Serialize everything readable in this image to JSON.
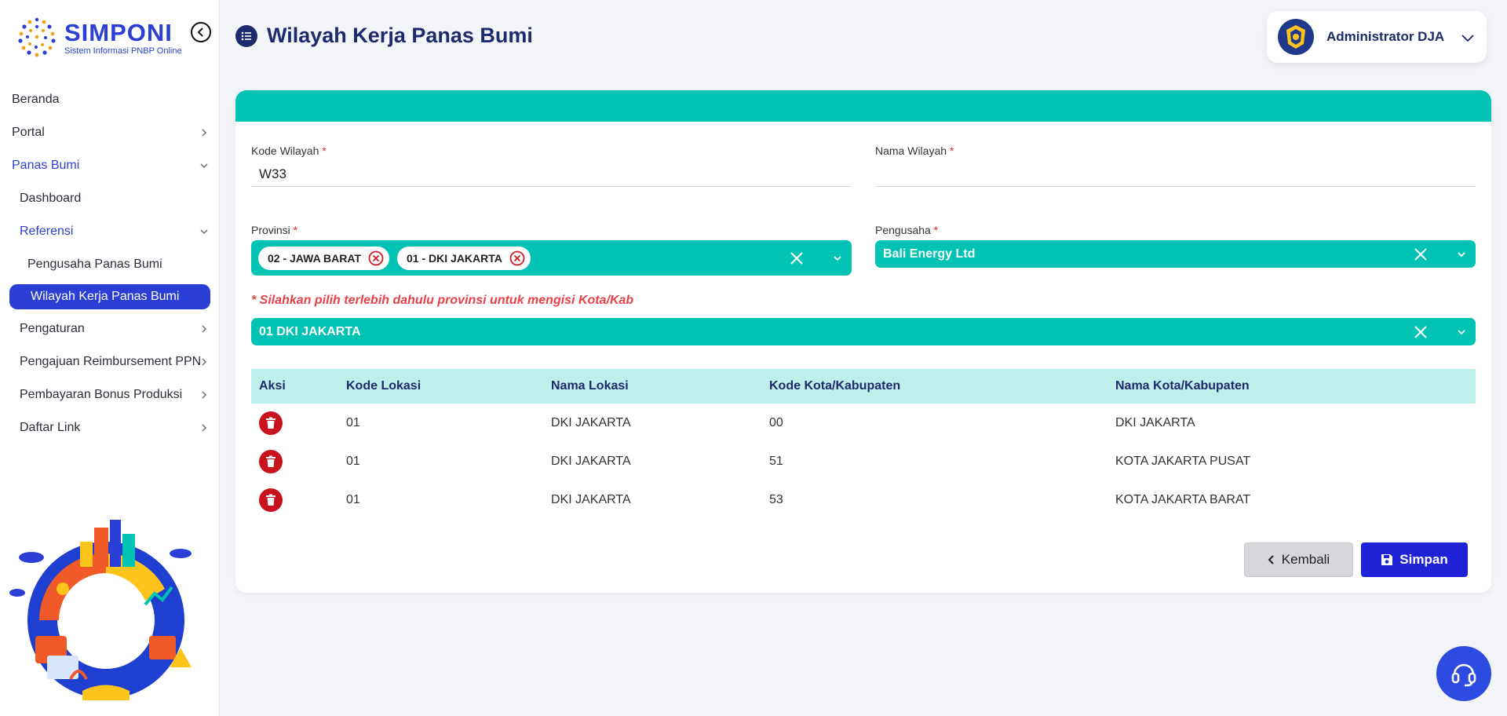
{
  "app": {
    "logo_title": "SIMPONI",
    "logo_subtitle": "Sistem Informasi PNBP Online",
    "accent_color": "#2b3fd6",
    "teal_color": "#00c3b3"
  },
  "sidebar": {
    "items": [
      {
        "label": "Beranda"
      },
      {
        "label": "Portal"
      },
      {
        "label": "Panas Bumi"
      },
      {
        "label": "Dashboard"
      },
      {
        "label": "Referensi"
      },
      {
        "label": "Pengusaha Panas Bumi"
      },
      {
        "label": "Wilayah Kerja Panas Bumi"
      },
      {
        "label": "Pengaturan"
      },
      {
        "label": "Pengajuan Reimbursement PPN"
      },
      {
        "label": "Pembayaran Bonus Produksi"
      },
      {
        "label": "Daftar Link"
      }
    ]
  },
  "header": {
    "title": "Wilayah Kerja Panas Bumi",
    "user_name": "Administrator DJA"
  },
  "form": {
    "kode_label": "Kode Wilayah",
    "kode_value": "W33",
    "nama_label": "Nama Wilayah",
    "nama_value": "",
    "provinsi_label": "Provinsi",
    "provinsi_chips": [
      "02 - JAWA BARAT",
      "01 - DKI JAKARTA"
    ],
    "pengusaha_label": "Pengusaha",
    "pengusaha_value": "Bali Energy Ltd",
    "required_mark": "*",
    "hint": "* Silahkan pilih terlebih dahulu provinsi untuk mengisi Kota/Kab",
    "kota_select_value": "01 DKI JAKARTA"
  },
  "table": {
    "headers": [
      "Aksi",
      "Kode Lokasi",
      "Nama Lokasi",
      "Kode Kota/Kabupaten",
      "Nama Kota/Kabupaten"
    ],
    "rows": [
      {
        "kode_lokasi": "01",
        "nama_lokasi": "DKI JAKARTA",
        "kode_kota": "00",
        "nama_kota": "DKI JAKARTA"
      },
      {
        "kode_lokasi": "01",
        "nama_lokasi": "DKI JAKARTA",
        "kode_kota": "51",
        "nama_kota": "KOTA JAKARTA PUSAT"
      },
      {
        "kode_lokasi": "01",
        "nama_lokasi": "DKI JAKARTA",
        "kode_kota": "53",
        "nama_kota": "KOTA JAKARTA BARAT"
      }
    ]
  },
  "actions": {
    "back_label": "Kembali",
    "save_label": "Simpan"
  },
  "icons": {
    "collapse": "chevron-left-circle-icon",
    "title": "list-icon",
    "delete": "trash-icon",
    "save": "floppy-disk-icon",
    "help": "headset-icon"
  }
}
